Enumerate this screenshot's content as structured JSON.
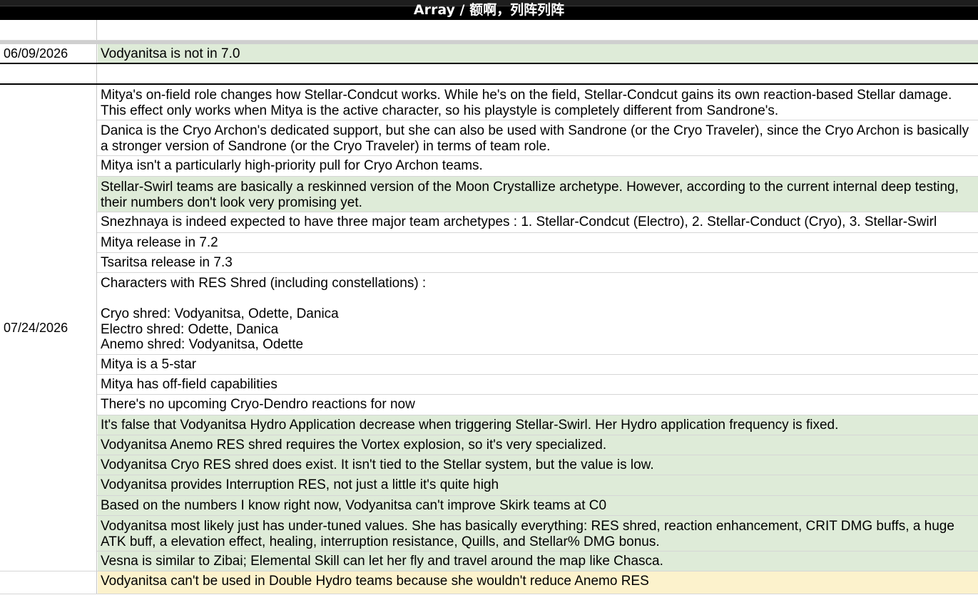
{
  "header": {
    "title": "Array / 额啊，列阵列阵"
  },
  "section1": {
    "date": "06/09/2026",
    "text": "Vodyanitsa is not in 7.0"
  },
  "section2": {
    "date": "07/24/2026",
    "rows": [
      {
        "text": "Mitya's on-field role changes how Stellar-Condcut works. While he's on the field, Stellar-Condcut gains its own reaction-based Stellar damage. This effect only works when Mitya is the active character, so his playstyle is completely different from Sandrone's."
      },
      {
        "text": "Danica is the Cryo Archon's dedicated support, but she can also be used with Sandrone (or the Cryo Traveler), since the Cryo Archon is basically a stronger version of Sandrone (or the Cryo Traveler) in terms of team role."
      },
      {
        "text": "Mitya isn't a particularly high-priority pull for Cryo Archon teams."
      },
      {
        "text": "Stellar-Swirl teams are basically a reskinned version of the Moon Crystallize archetype. However, according to the current internal deep testing, their numbers don't look very promising yet."
      },
      {
        "text": "Snezhnaya is indeed expected to have three major team archetypes : 1. Stellar-Condcut (Electro), 2. Stellar-Conduct (Cryo), 3. Stellar-Swirl"
      },
      {
        "text": "Mitya release in 7.2"
      },
      {
        "text": "Tsaritsa release in 7.3"
      },
      {
        "text": "Characters with RES Shred (including constellations) :\n\nCryo shred: Vodyanitsa, Odette, Danica\nElectro shred: Odette, Danica\nAnemo shred: Vodyanitsa, Odette"
      },
      {
        "text": "Mitya is a 5-star"
      },
      {
        "text": "Mitya has off-field capabilities"
      },
      {
        "text": "There's no upcoming Cryo-Dendro reactions for now"
      },
      {
        "text": "It's false that Vodyanitsa Hydro Application decrease when triggering Stellar-Swirl. Her Hydro application frequency is fixed."
      },
      {
        "text": "Vodyanitsa Anemo RES shred requires the Vortex explosion, so it's very specialized."
      },
      {
        "text": "Vodyanitsa Cryo RES shred does exist. It isn't tied to the Stellar system, but the value is low."
      },
      {
        "text": "Vodyanitsa provides Interruption RES, not just a little it's quite high"
      },
      {
        "text": "Based on the numbers I know right now, Vodyanitsa can't improve Skirk teams at C0"
      },
      {
        "text": "Vodyanitsa most likely just has under-tuned values. She has basically everything: RES shred, reaction enhancement, CRIT DMG buffs, a huge ATK buff, a elevation effect, healing, interruption resistance, Quills, and Stellar% DMG bonus."
      },
      {
        "text": "Vesna is similar to Zibai; Elemental Skill can let her fly and travel around the map like Chasca."
      }
    ]
  },
  "section3": {
    "rows": [
      {
        "text": "Vodyanitsa can't be used in Double Hydro teams because she wouldn't reduce Anemo RES"
      }
    ]
  },
  "colors": {
    "green": "#deebd8",
    "yellow": "#fcf2cc",
    "header": "#000000"
  }
}
